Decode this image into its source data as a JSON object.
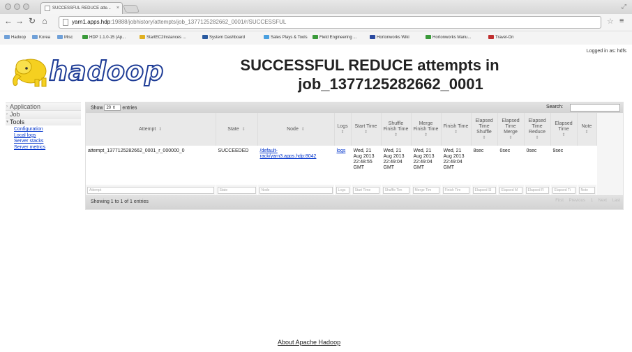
{
  "browser": {
    "tab_title": "SUCCESSFUL REDUCE atte...",
    "tab_close": "×",
    "url_host": "yarn1.apps.hdp",
    "url_path": ":19888/jobhistory/attempts/job_1377125282662_0001/r/SUCCESSFUL",
    "bookmarks": [
      {
        "label": "Hadoop",
        "color": "#6fa0d8"
      },
      {
        "label": "Korea",
        "color": "#6fa0d8"
      },
      {
        "label": "Misc",
        "color": "#6fa0d8"
      },
      {
        "label": "HDP 1.1.0-15 (Ap...",
        "color": "#3a9a3a"
      },
      {
        "label": "StartEC2Instances ...",
        "color": "#e0b020"
      },
      {
        "label": "System Dashboard",
        "color": "#2a5aa0"
      },
      {
        "label": "Sales Plays & Tools",
        "color": "#4aa0e0"
      },
      {
        "label": "Field Engineering ...",
        "color": "#3a9a3a"
      },
      {
        "label": "Hortonworks Wiki",
        "color": "#2a4aa0"
      },
      {
        "label": "Hortonworks Manu...",
        "color": "#3a9a3a"
      },
      {
        "label": "Travel-On",
        "color": "#c03030"
      }
    ]
  },
  "header": {
    "logged_in": "Logged in as: hdfs",
    "logo_text": "hadoop",
    "title_line1": "SUCCESSFUL REDUCE attempts in",
    "title_line2": "job_1377125282662_0001"
  },
  "sidebar": {
    "sections": [
      {
        "label": "Application",
        "arrow": "›"
      },
      {
        "label": "Job",
        "arrow": "›"
      },
      {
        "label": "Tools",
        "arrow": "▾"
      }
    ],
    "tool_links": [
      "Configuration",
      "Local logs",
      "Server stacks",
      "Server metrics"
    ]
  },
  "table": {
    "show_label_pre": "Show",
    "page_length": "20",
    "show_label_post": "entries",
    "search_label": "Search:",
    "sort_glyph": "⇕",
    "columns": [
      "Attempt",
      "State",
      "Node",
      "Logs",
      "Start Time",
      "Shuffle Finish Time",
      "Merge Finish Time",
      "Finish Time",
      "Elapsed Time Shuffle",
      "Elapsed Time Merge",
      "Elapsed Time Reduce",
      "Elapsed Time",
      "Note"
    ],
    "rows": [
      {
        "attempt": "attempt_1377125282662_0001_r_000000_0",
        "state": "SUCCEEDED",
        "node": "/default-rack/yarn3.apps.hdp:8042",
        "logs": "logs",
        "start_time": "Wed, 21 Aug 2013 22:48:55 GMT",
        "shuffle_finish": "Wed, 21 Aug 2013 22:49:04 GMT",
        "merge_finish": "Wed, 21 Aug 2013 22:49:04 GMT",
        "finish_time": "Wed, 21 Aug 2013 22:49:04 GMT",
        "elapsed_shuffle": "8sec",
        "elapsed_merge": "0sec",
        "elapsed_reduce": "0sec",
        "elapsed_time": "9sec",
        "note": ""
      }
    ],
    "filters": [
      "Attempt",
      "State",
      "Node",
      "Logs",
      "Start Time",
      "Shuffle Tim",
      "Merge Tim",
      "Finish Tim",
      "Elapsed Sl",
      "Elapsed M",
      "Elapsed R",
      "Elapsed Ti",
      "Note"
    ],
    "info": "Showing 1 to 1 of 1 entries",
    "pager": [
      "First",
      "Previous",
      "1",
      "Next",
      "Last"
    ]
  },
  "footer": {
    "about": "About Apache Hadoop"
  }
}
